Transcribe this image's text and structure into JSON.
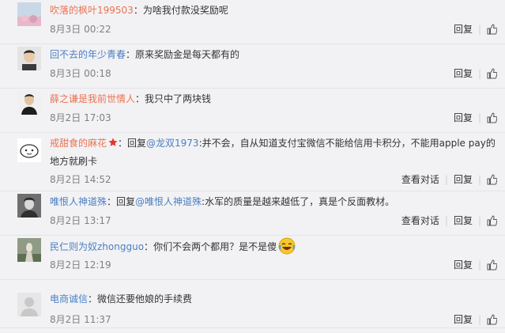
{
  "labels": {
    "reply": "回复",
    "view_conversation": "查看对话"
  },
  "comments": [
    {
      "user": "吹落的枫叶199503",
      "sep": "：",
      "text": "为啥我付款没奖励呢",
      "time": "8月3日 00:22"
    },
    {
      "user": "回不去的年少青春",
      "sep": "：",
      "text": "原来奖励金是每天都有的",
      "time": "8月3日 00:18"
    },
    {
      "user": "薛之谦是我前世情人",
      "sep": "：",
      "text": "我只中了两块钱",
      "time": "8月2日 17:03"
    },
    {
      "user": "戒甜食的麻花",
      "prefix": "：回复",
      "mention": "@龙双1973",
      "text": ":并不会，自从知道支付宝微信不能给信用卡积分，不能用apple pay的地方就刷卡",
      "time": "8月2日 14:52"
    },
    {
      "user": "唯恨人神道殊",
      "prefix": "：回复",
      "mention": "@唯恨人神道殊",
      "text": ":水军的质量是越来越低了，真是个反面教材。",
      "time": "8月2日 13:17"
    },
    {
      "user": "民仁则为奴zhongguo",
      "sep": "：",
      "text": "你们不会两个都用？是不是傻",
      "time": "8月2日 12:19"
    },
    {
      "user": "电商诚信",
      "sep": "：",
      "text": "微信还要他娘的手续费",
      "time": "8月2日 11:37"
    }
  ],
  "colors": {
    "username": "#eb7350",
    "link": "#4a7fc1",
    "meta": "#808080",
    "text": "#333333",
    "background": "#f2f2f5"
  }
}
